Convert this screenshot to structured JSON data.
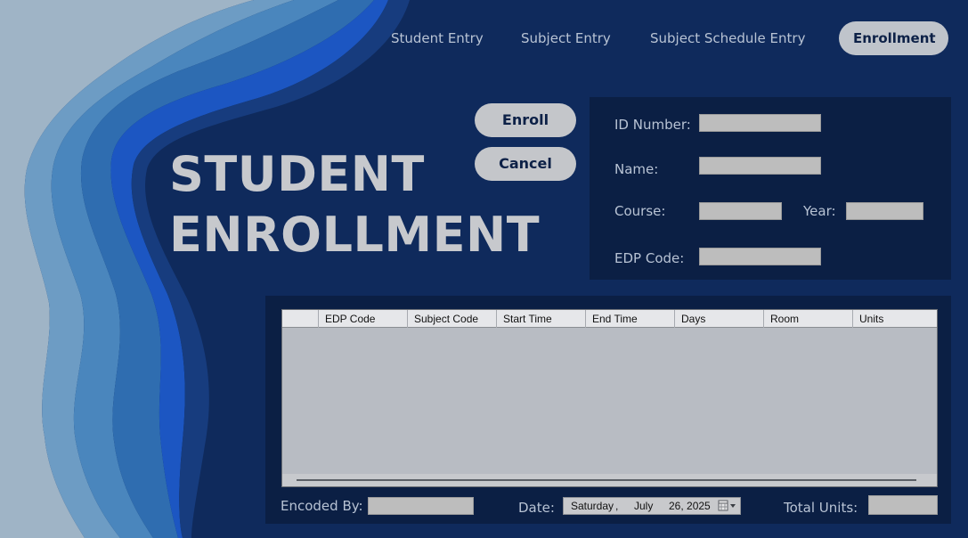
{
  "nav": {
    "student_entry": "Student Entry",
    "subject_entry": "Subject Entry",
    "subject_schedule_entry": "Subject Schedule Entry",
    "enrollment": "Enrollment"
  },
  "title": {
    "line1": "STUDENT",
    "line2": "ENROLLMENT"
  },
  "buttons": {
    "enroll": "Enroll",
    "cancel": "Cancel"
  },
  "form": {
    "id_number_label": "ID Number:",
    "name_label": "Name:",
    "course_label": "Course:",
    "year_label": "Year:",
    "edp_code_label": "EDP Code:",
    "id_number_value": "",
    "name_value": "",
    "course_value": "",
    "year_value": "",
    "edp_code_value": ""
  },
  "grid": {
    "columns": [
      "EDP Code",
      "Subject Code",
      "Start Time",
      "End Time",
      "Days",
      "Room",
      "Units"
    ],
    "rows": []
  },
  "footer": {
    "encoded_by_label": "Encoded By:",
    "date_label": "Date:",
    "total_units_label": "Total Units:",
    "encoded_by_value": "",
    "total_units_value": "",
    "date": {
      "weekday": "Saturday",
      "comma": ",",
      "month": "July",
      "day_year": "26, 2025"
    }
  },
  "icons": {
    "calendar": "calendar-icon",
    "dropdown": "chevron-down-icon"
  },
  "colors": {
    "background": "#0f2a5c",
    "panel": "#0b1f44",
    "button": "#c4c6ca",
    "text_dark": "#0d2147"
  }
}
